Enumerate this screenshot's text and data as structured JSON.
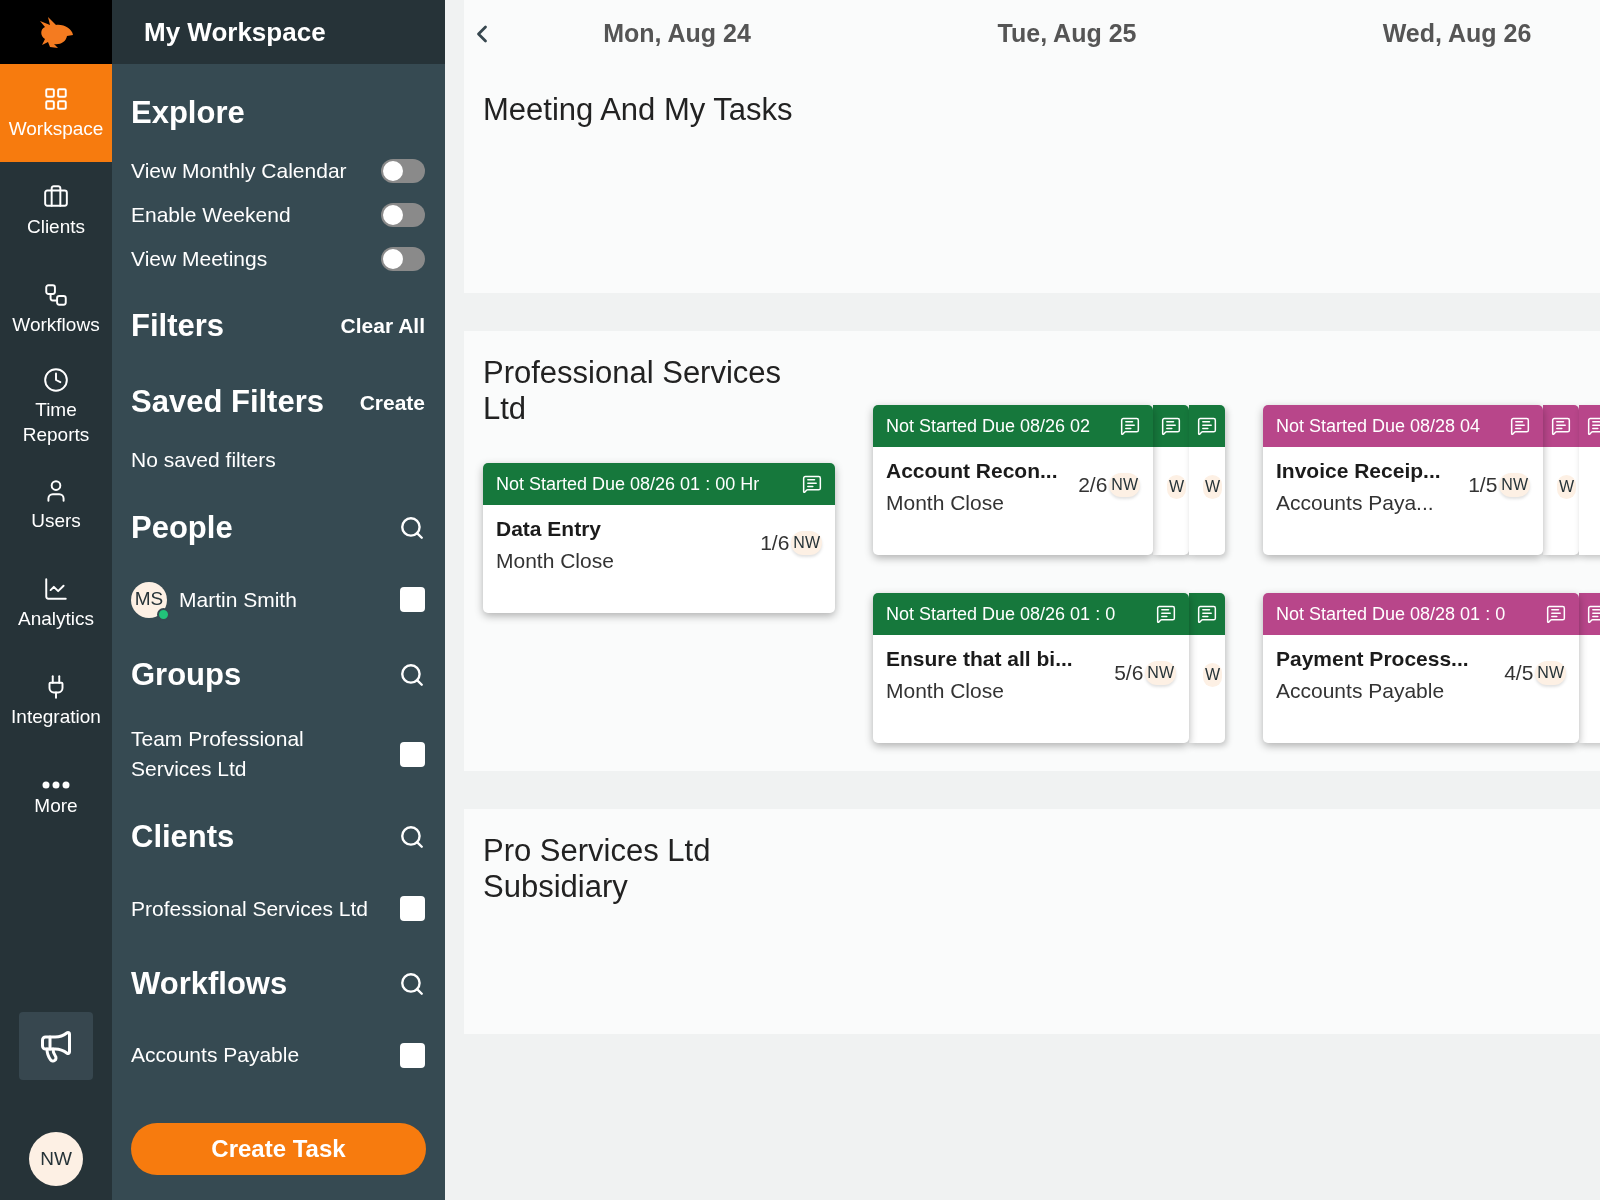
{
  "nav": {
    "items": [
      {
        "label": "Workspace",
        "selected": true
      },
      {
        "label": "Clients",
        "selected": false
      },
      {
        "label": "Workflows",
        "selected": false
      },
      {
        "label": "Time Reports",
        "selected": false
      },
      {
        "label": "Users",
        "selected": false
      },
      {
        "label": "Analytics",
        "selected": false
      },
      {
        "label": "Integration",
        "selected": false
      },
      {
        "label": "More",
        "selected": false
      }
    ],
    "user_avatar": "NW"
  },
  "panel": {
    "title": "My Workspace",
    "explore": {
      "title": "Explore",
      "toggles": [
        {
          "label": "View Monthly Calendar",
          "on": false
        },
        {
          "label": "Enable Weekend",
          "on": false
        },
        {
          "label": "View Meetings",
          "on": false
        }
      ]
    },
    "filters": {
      "title": "Filters",
      "action": "Clear All"
    },
    "saved_filters": {
      "title": "Saved Filters",
      "action": "Create",
      "empty": "No saved filters"
    },
    "lists": [
      {
        "title": "People",
        "items": [
          {
            "initials": "MS",
            "name": "Martin Smith",
            "online": true,
            "checked": false
          }
        ]
      },
      {
        "title": "Groups",
        "items": [
          {
            "name": "Team Professional Services Ltd",
            "checked": false
          }
        ]
      },
      {
        "title": "Clients",
        "items": [
          {
            "name": "Professional Services Ltd",
            "checked": false
          }
        ]
      },
      {
        "title": "Workflows",
        "items": [
          {
            "name": "Accounts Payable",
            "checked": false
          }
        ]
      }
    ],
    "create_button": "Create Task"
  },
  "calendar": {
    "days": [
      "Mon, Aug 24",
      "Tue, Aug 25",
      "Wed, Aug 26"
    ],
    "sections": [
      {
        "title": "Meeting And My Tasks",
        "columns": [
          [],
          [],
          []
        ]
      },
      {
        "title": "Professional Services Ltd",
        "columns": [
          [
            {
              "color": "#16783c",
              "header": "Not Started Due 08/26 01 : 00 Hr",
              "title": "Data Entry",
              "subtitle": "Month Close",
              "progress": "1/6",
              "avatar": "NW"
            }
          ],
          [
            {
              "color": "#16783c",
              "header": "Not Started Due 08/26 02",
              "title": "Account Recon...",
              "subtitle": "Month Close",
              "progress": "2/6",
              "avatar": "NW",
              "layers": [
                "W",
                "W"
              ]
            },
            {
              "color": "#16783c",
              "header": "Not Started Due 08/26 01 : 0",
              "title": "Ensure that all bi...",
              "subtitle": "Month Close",
              "progress": "5/6",
              "avatar": "NW",
              "layers": [
                "W"
              ]
            }
          ],
          [
            {
              "color": "#b8468a",
              "header": "Not Started Due 08/28 04",
              "title": "Invoice Receip...",
              "subtitle": "Accounts Paya...",
              "progress": "1/5",
              "avatar": "NW",
              "layers": [
                "W"
              ],
              "edge_layer": true
            },
            {
              "color": "#b8468a",
              "header": "Not Started Due 08/28 01 : 0",
              "title": "Payment Process...",
              "subtitle": "Accounts Payable",
              "progress": "4/5",
              "avatar": "NW",
              "edge_layer": true
            }
          ]
        ]
      },
      {
        "title": "Pro Services Ltd Subsidiary",
        "columns": [
          [],
          [],
          []
        ]
      }
    ]
  }
}
